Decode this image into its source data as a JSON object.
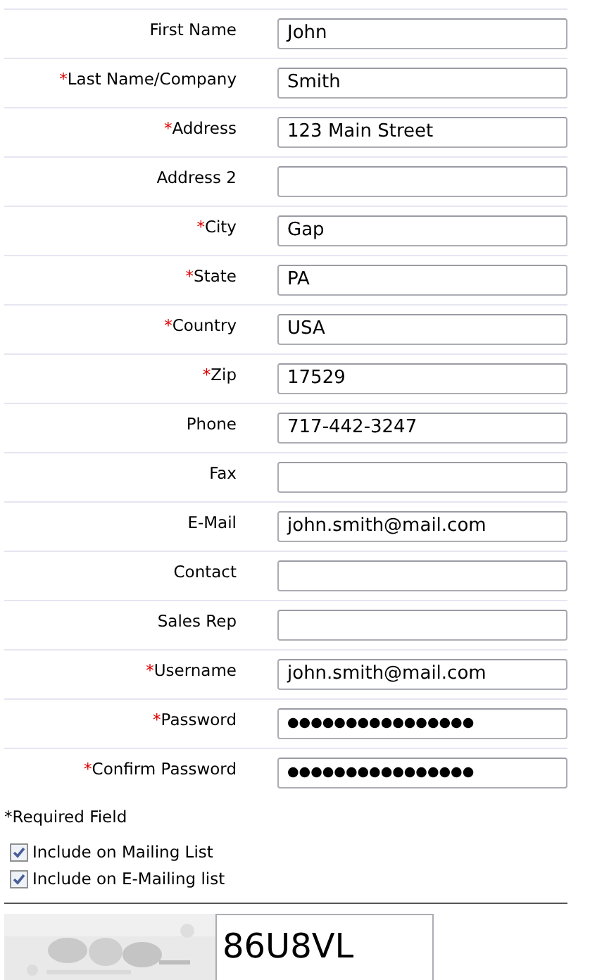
{
  "fields": [
    {
      "label": "First Name",
      "value": "John"
    },
    {
      "label": "Last Name/Company",
      "required_mark": "*",
      "value": "Smith"
    },
    {
      "label": "Address",
      "required_mark": "*",
      "value": "123 Main Street"
    },
    {
      "label": "Address 2"
    },
    {
      "label": "City",
      "required_mark": "*",
      "value": "Gap"
    },
    {
      "label": "State",
      "required_mark": "*",
      "value": "PA"
    },
    {
      "label": "Country",
      "required_mark": "*",
      "value": "USA"
    },
    {
      "label": "Zip",
      "required_mark": "*",
      "value": "17529"
    },
    {
      "label": "Phone",
      "value": "717-442-3247"
    },
    {
      "label": "Fax"
    },
    {
      "label": "E-Mail",
      "value": "john.smith@mail.com"
    },
    {
      "label": "Contact"
    },
    {
      "label": "Sales Rep"
    },
    {
      "label": "Username",
      "required_mark": "*",
      "value": "john.smith@mail.com"
    },
    {
      "label": "Password",
      "required_mark": "*",
      "value": "●●●●●●●●●●●●●●●●",
      "kind": "password"
    },
    {
      "label": "Confirm Password",
      "required_mark": "*",
      "value": "●●●●●●●●●●●●●●●●",
      "kind": "password"
    }
  ],
  "required_note": "*Required Field",
  "options": [
    {
      "label": "Include on Mailing List",
      "checked": true
    },
    {
      "label": "Include on E-Mailing list",
      "checked": true
    }
  ],
  "captcha": {
    "value": "86U8VL"
  }
}
